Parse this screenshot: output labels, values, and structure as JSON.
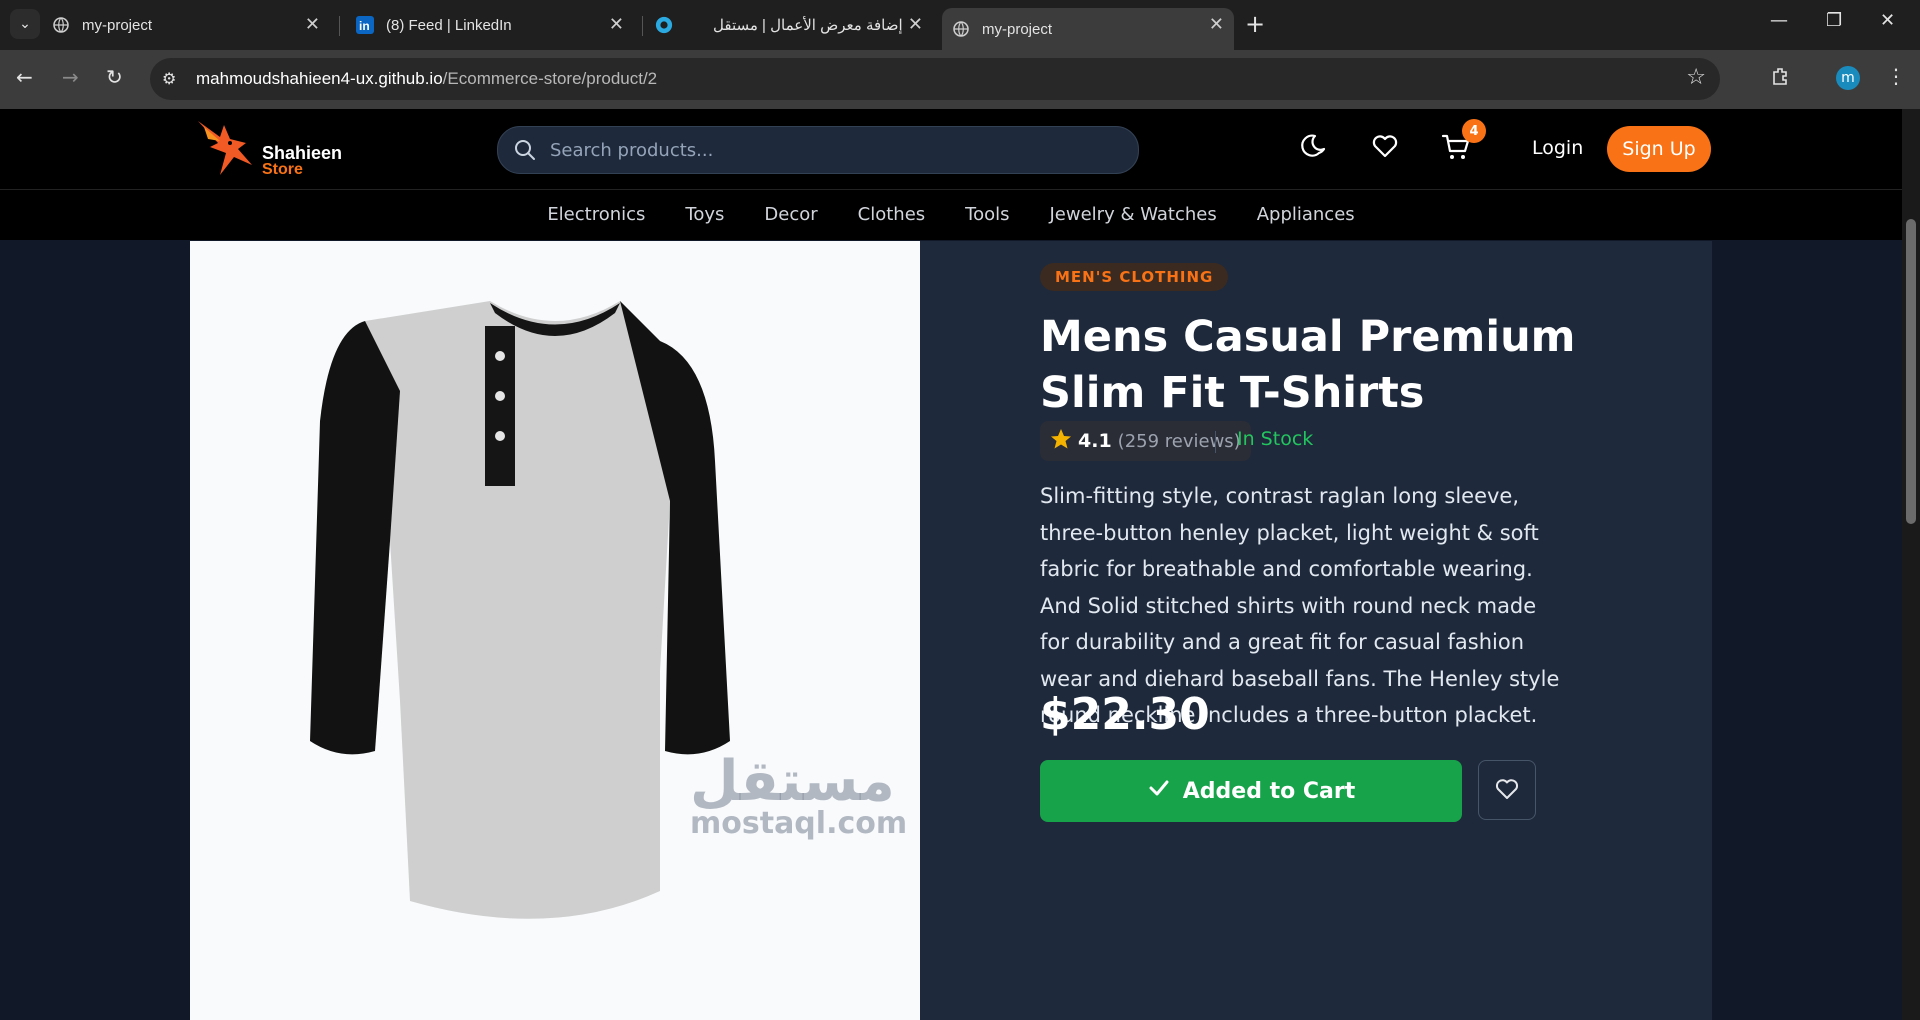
{
  "browser": {
    "tabs": [
      {
        "title": "my-project",
        "icon": "globe-icon"
      },
      {
        "title": "(8) Feed | LinkedIn",
        "icon": "linkedin-icon"
      },
      {
        "title": "إضافة معرض الأعمال | مستقل",
        "icon": "mostaql-icon"
      },
      {
        "title": "my-project",
        "icon": "globe-icon",
        "active": true
      }
    ],
    "url_host": "mahmoudshahieen4-ux.github.io",
    "url_path": "/Ecommerce-store/product/2",
    "profile_initial": "m"
  },
  "header": {
    "logo_line1": "Shahieen",
    "logo_line2": "Store",
    "search_placeholder": "Search products...",
    "cart_count": "4",
    "login_label": "Login",
    "signup_label": "Sign Up"
  },
  "categories": [
    "Electronics",
    "Toys",
    "Decor",
    "Clothes",
    "Tools",
    "Jewelry & Watches",
    "Appliances"
  ],
  "product": {
    "category_badge": "MEN'S CLOTHING",
    "title": "Mens Casual Premium Slim Fit T-Shirts",
    "rating": "4.1",
    "reviews": "(259 reviews)",
    "stock": "In Stock",
    "description": "Slim-fitting style, contrast raglan long sleeve, three-button henley placket, light weight & soft fabric for breathable and comfortable wearing. And Solid stitched shirts with round neck made for durability and a great fit for casual fashion wear and diehard baseball fans. The Henley style round neckline includes a three-button placket.",
    "price": "$22.30",
    "added_label": "Added to Cart"
  },
  "watermark": {
    "arabic": "مستقل",
    "latin": "mostaql.com"
  },
  "colors": {
    "accent": "#f97316",
    "success": "#16a34a",
    "page_bg": "#111827",
    "card_bg": "#1e293b"
  }
}
